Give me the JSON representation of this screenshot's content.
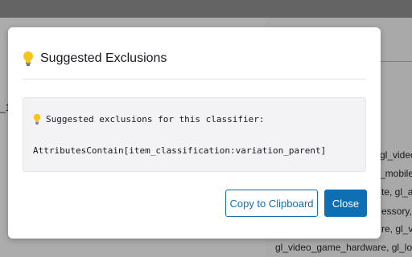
{
  "background": {
    "partial_left_text": "_1",
    "lines": [
      "gl_video_",
      "_mobile_",
      "te, gl_ar",
      "essory, gl",
      "re, gl_vide",
      "gl_video_game_hardware, gl_local_"
    ]
  },
  "modal": {
    "title": "Suggested Exclusions",
    "title_icon": "lightbulb-icon",
    "message": "Suggested exclusions for this classifier:",
    "rule": "AttributesContain[item_classification:variation_parent]",
    "copy_button": "Copy to Clipboard",
    "close_button": "Close"
  },
  "colors": {
    "primary": "#0f6fb5",
    "bulb": "#f5c518"
  }
}
